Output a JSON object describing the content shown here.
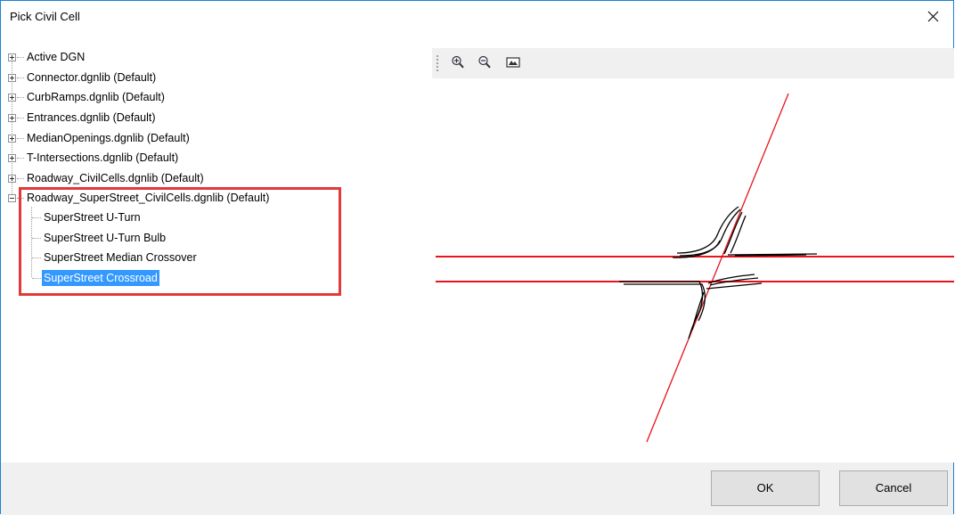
{
  "window": {
    "title": "Pick Civil Cell"
  },
  "tree": {
    "libraries": [
      {
        "label": "Active DGN",
        "expanded": false
      },
      {
        "label": "Connector.dgnlib (Default)",
        "expanded": false
      },
      {
        "label": "CurbRamps.dgnlib (Default)",
        "expanded": false
      },
      {
        "label": "Entrances.dgnlib (Default)",
        "expanded": false
      },
      {
        "label": "MedianOpenings.dgnlib (Default)",
        "expanded": false
      },
      {
        "label": "T-Intersections.dgnlib (Default)",
        "expanded": false
      },
      {
        "label": "Roadway_CivilCells.dgnlib (Default)",
        "expanded": false
      },
      {
        "label": "Roadway_SuperStreet_CivilCells.dgnlib (Default)",
        "expanded": true
      }
    ],
    "children": [
      {
        "label": "SuperStreet U-Turn",
        "selected": false
      },
      {
        "label": "SuperStreet U-Turn Bulb",
        "selected": false
      },
      {
        "label": "SuperStreet Median Crossover",
        "selected": false
      },
      {
        "label": "SuperStreet Crossroad",
        "selected": true
      }
    ]
  },
  "preview": {
    "toolbar": [
      {
        "icon": "zoom-in-icon"
      },
      {
        "icon": "zoom-out-icon"
      },
      {
        "icon": "fit-view-icon"
      }
    ]
  },
  "buttons": {
    "ok": "OK",
    "cancel": "Cancel"
  },
  "colors": {
    "selection": "#3399ff",
    "highlight": "#e03a3a",
    "preview_line": "#e8141b",
    "dialog_border": "#1883d7"
  }
}
